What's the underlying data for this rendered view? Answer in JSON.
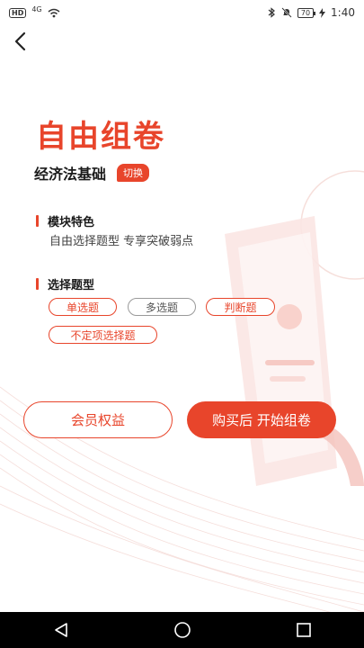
{
  "status_bar": {
    "left_badge": "HD",
    "network": "4G",
    "battery": "70",
    "time": "1:40"
  },
  "icons": {
    "back": "back-arrow-icon",
    "wifi": "wifi-icon",
    "bluetooth": "bluetooth-icon",
    "mute": "bell-muted-icon",
    "charging": "charging-icon"
  },
  "page": {
    "title": "自由组卷",
    "subject": "经济法基础",
    "switch_label": "切换"
  },
  "module_features": {
    "heading": "模块特色",
    "description": "自由选择题型 专享突破弱点"
  },
  "question_types": {
    "heading": "选择题型",
    "options": [
      {
        "label": "单选题",
        "selected": true
      },
      {
        "label": "多选题",
        "selected": false
      },
      {
        "label": "判断题",
        "selected": true
      },
      {
        "label": "不定项选择题",
        "selected": true
      }
    ]
  },
  "actions": {
    "member_label": "会员权益",
    "buy_label": "购买后 开始组卷"
  },
  "colors": {
    "accent": "#e8452b",
    "unselected": "#9a9a9a"
  }
}
